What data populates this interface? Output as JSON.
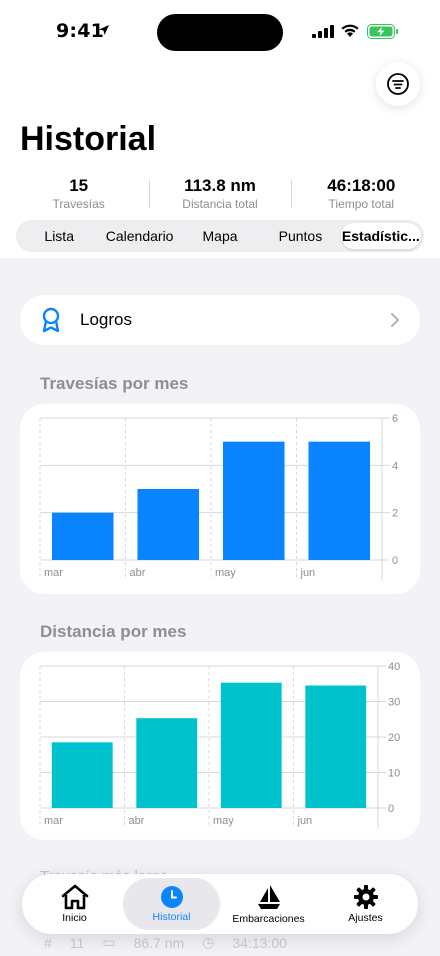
{
  "status": {
    "time": "9:41"
  },
  "header": {
    "title": "Historial"
  },
  "stats": [
    {
      "value": "15",
      "label": "Travesías"
    },
    {
      "value": "113.8 nm",
      "label": "Distancia total"
    },
    {
      "value": "46:18:00",
      "label": "Tiempo total"
    }
  ],
  "tabs_segment": [
    "Lista",
    "Calendario",
    "Mapa",
    "Puntos",
    "Estadístic..."
  ],
  "logros": {
    "label": "Logros"
  },
  "sections": {
    "trips_title": "Travesías por mes",
    "distance_title": "Distancia por mes",
    "next_title": "Travesía más larga"
  },
  "peek_row": {
    "count": "11",
    "distance": "86.7 nm",
    "time": "34:13:00"
  },
  "tabbar": [
    {
      "label": "Inicio",
      "icon": "house-icon"
    },
    {
      "label": "Historial",
      "icon": "clock-icon"
    },
    {
      "label": "Embarcaciones",
      "icon": "sailboat-icon"
    },
    {
      "label": "Ajustes",
      "icon": "gear-icon"
    }
  ],
  "colors": {
    "accent": "#0a84ff",
    "teal": "#00c2cc"
  },
  "chart_data": [
    {
      "type": "bar",
      "title": "Travesías por mes",
      "categories": [
        "mar",
        "abr",
        "may",
        "jun"
      ],
      "values": [
        2,
        3,
        5,
        5
      ],
      "ylim": [
        0,
        6
      ],
      "yticks": [
        0,
        2,
        4,
        6
      ],
      "color": "#0a84ff",
      "grid": true
    },
    {
      "type": "bar",
      "title": "Distancia por mes",
      "categories": [
        "mar",
        "abr",
        "may",
        "jun"
      ],
      "values": [
        18.5,
        25.3,
        35.3,
        34.5
      ],
      "ylim": [
        0,
        40
      ],
      "yticks": [
        0,
        10,
        20,
        30,
        40
      ],
      "color": "#00c2cc",
      "grid": true
    }
  ]
}
